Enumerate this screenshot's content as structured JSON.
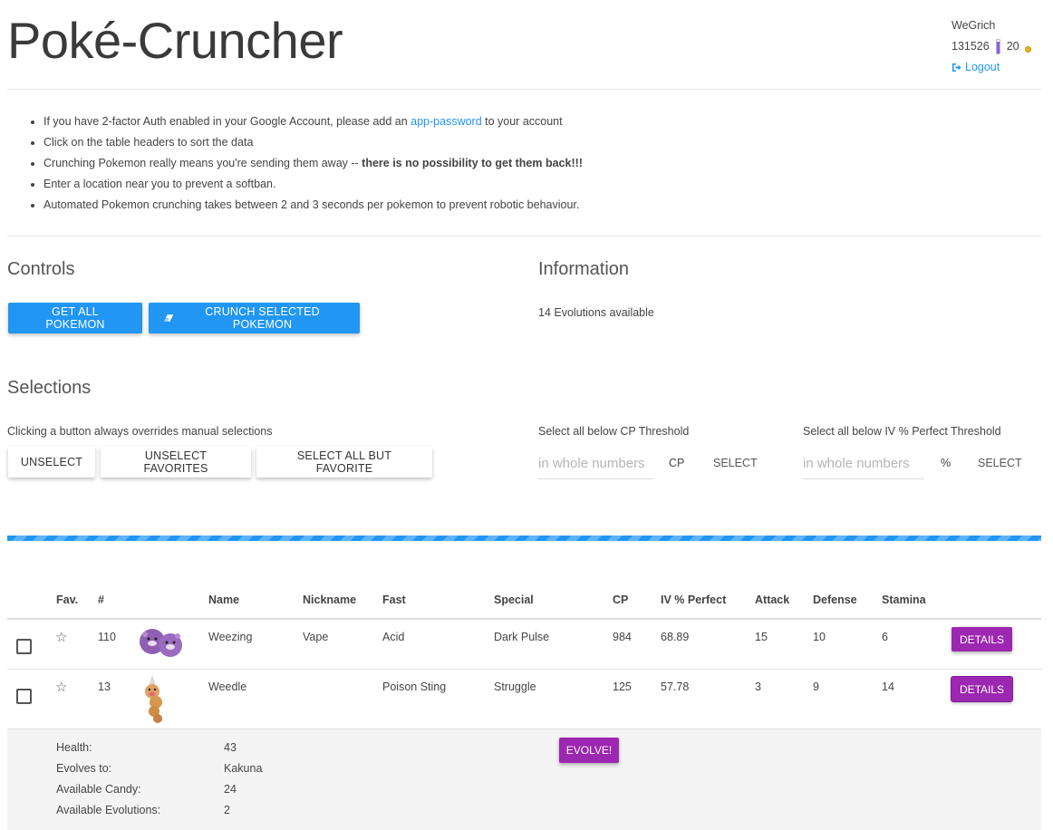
{
  "header": {
    "title": "Poké-Cruncher",
    "username": "WeGrich",
    "stardust": "131526",
    "xp_fraction": 0.85,
    "coins": "20",
    "logout_label": "Logout"
  },
  "tips": {
    "item1_before": "If you have 2-factor Auth enabled in your Google Account, please add an ",
    "item1_link": "app-password",
    "item1_after": " to your account",
    "item2": "Click on the table headers to sort the data",
    "item3_before": "Crunching Pokemon really means you're sending them away -- ",
    "item3_bold": "there is no possibility to get them back!!!",
    "item4": "Enter a location near you to prevent a softban.",
    "item5": "Automated Pokemon crunching takes between 2 and 3 seconds per pokemon to prevent robotic behaviour."
  },
  "controls": {
    "title": "Controls",
    "get_all": "GET ALL POKEMON",
    "crunch": "CRUNCH SELECTED POKEMON"
  },
  "information": {
    "title": "Information",
    "text": "14 Evolutions available"
  },
  "selections": {
    "title": "Selections",
    "note": "Clicking a button always overrides manual selections",
    "unselect": "UNSELECT",
    "unselect_favorites": "UNSELECT FAVORITES",
    "select_all_but_favorite": "SELECT ALL BUT FAVORITE",
    "cp_label": "Select all below CP Threshold",
    "cp_placeholder": "in whole numbers",
    "cp_unit": "CP",
    "cp_select": "SELECT",
    "iv_label": "Select all below IV % Perfect Threshold",
    "iv_placeholder": "in whole numbers",
    "iv_unit": "%",
    "iv_select": "SELECT"
  },
  "table": {
    "headers": {
      "fav": "Fav.",
      "num": "#",
      "name": "Name",
      "nickname": "Nickname",
      "fast": "Fast",
      "special": "Special",
      "cp": "CP",
      "iv": "IV % Perfect",
      "attack": "Attack",
      "defense": "Defense",
      "stamina": "Stamina"
    },
    "rows": [
      {
        "num": "110",
        "name": "Weezing",
        "nickname": "Vape",
        "fast": "Acid",
        "special": "Dark Pulse",
        "cp": "984",
        "iv": "68.89",
        "attack": "15",
        "defense": "10",
        "stamina": "6",
        "details": "DETAILS",
        "sprite": "weezing-sprite"
      },
      {
        "num": "13",
        "name": "Weedle",
        "nickname": "",
        "fast": "Poison Sting",
        "special": "Struggle",
        "cp": "125",
        "iv": "57.78",
        "attack": "3",
        "defense": "9",
        "stamina": "14",
        "details": "DETAILS",
        "sprite": "weedle-sprite"
      }
    ],
    "expanded": {
      "health_label": "Health:",
      "health": "43",
      "evolves_label": "Evolves to:",
      "evolves": "Kakuna",
      "candy_label": "Available Candy:",
      "candy": "24",
      "evolutions_label": "Available Evolutions:",
      "evolutions": "2",
      "evolve_button": "EVOLVE!"
    }
  },
  "colors": {
    "primary": "#2196f3",
    "accent": "#9c27b0"
  }
}
